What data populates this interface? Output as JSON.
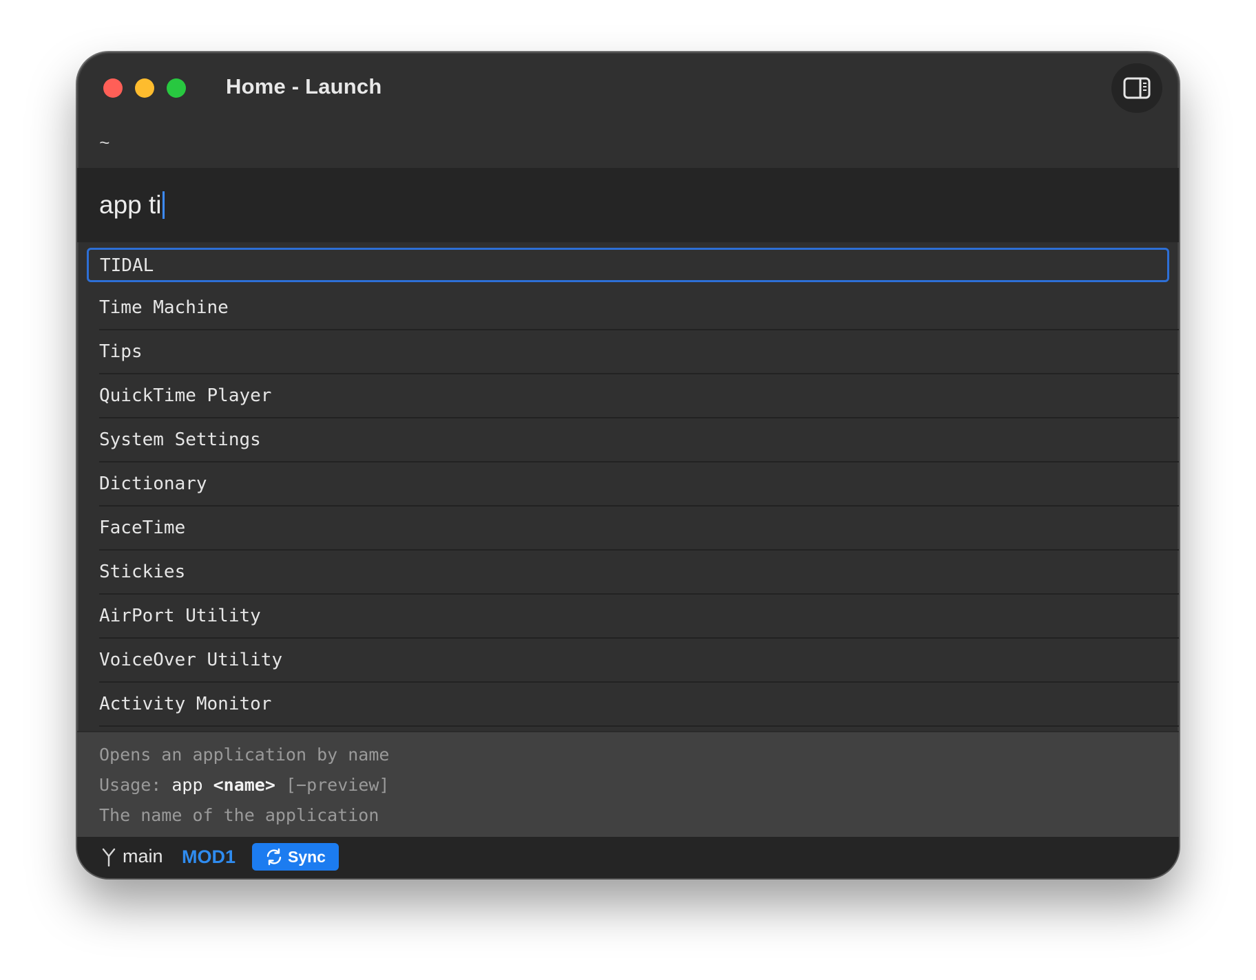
{
  "window": {
    "title": "Home - Launch",
    "path": "~"
  },
  "input": {
    "value": "app ti"
  },
  "results": [
    {
      "label": "TIDAL",
      "selected": true
    },
    {
      "label": "Time Machine"
    },
    {
      "label": "Tips"
    },
    {
      "label": "QuickTime Player"
    },
    {
      "label": "System Settings"
    },
    {
      "label": "Dictionary"
    },
    {
      "label": "FaceTime"
    },
    {
      "label": "Stickies"
    },
    {
      "label": "AirPort Utility"
    },
    {
      "label": "VoiceOver Utility"
    },
    {
      "label": "Activity Monitor"
    }
  ],
  "help": {
    "description": "Opens an application by name",
    "usage_label": "Usage:",
    "usage_command": "app",
    "usage_arg": "<name>",
    "usage_option": "[−preview]",
    "arg_description": "The name of the application"
  },
  "status": {
    "branch": "main",
    "mode": "MOD1",
    "sync_label": "Sync"
  },
  "colors": {
    "accent": "#2f8cf0",
    "selection_border": "#2d6fd6",
    "sync_button": "#1c7cf0"
  },
  "icons": {
    "sidebar_toggle": "sidebar-toggle-icon",
    "branch": "git-branch-icon",
    "sync": "sync-icon"
  }
}
